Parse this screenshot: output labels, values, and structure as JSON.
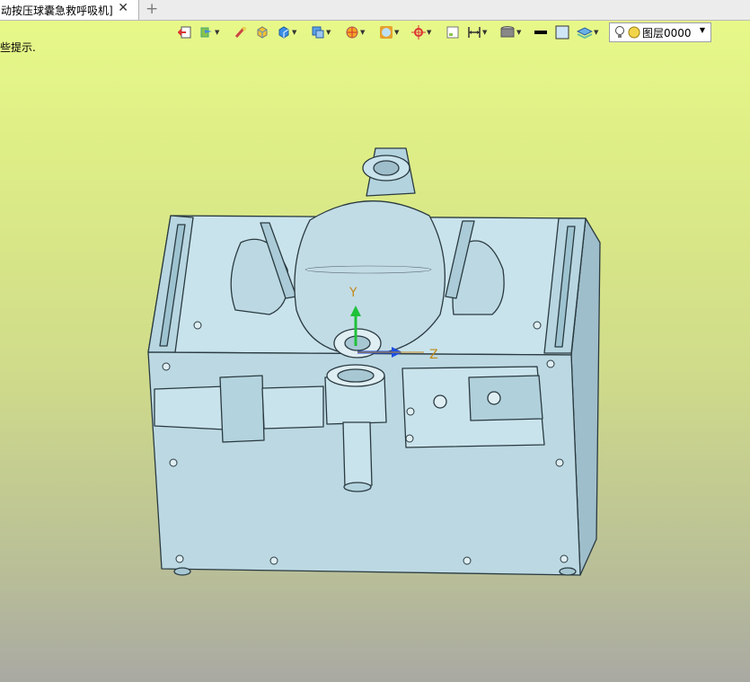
{
  "tab": {
    "title": "动按压球囊急救呼吸机]",
    "close_icon": "close-icon",
    "add_icon": "plus-icon"
  },
  "hint": {
    "text": "些提示."
  },
  "toolbar": {
    "layer_label": "图层0000",
    "icons": [
      "exit-icon",
      "layers-icon",
      "brush-icon",
      "box-shaded-icon",
      "box-blue-icon",
      "view-cube-icon",
      "render-icon",
      "frame-icon",
      "axis-icon",
      "grid-icon",
      "dimension-icon",
      "display-mode-icon",
      "line-color-swatch",
      "fill-color-swatch",
      "stack-icon",
      "bulb-icon",
      "sun-icon"
    ]
  },
  "model": {
    "axis_y_label": "Y",
    "axis_z_label": "Z",
    "colors": {
      "body": "#bcd9e3",
      "line": "#2a3a40",
      "axis_y": "#1fc13a",
      "axis_z": "#1d4fe0",
      "axis_label": "#c28a1e"
    }
  }
}
